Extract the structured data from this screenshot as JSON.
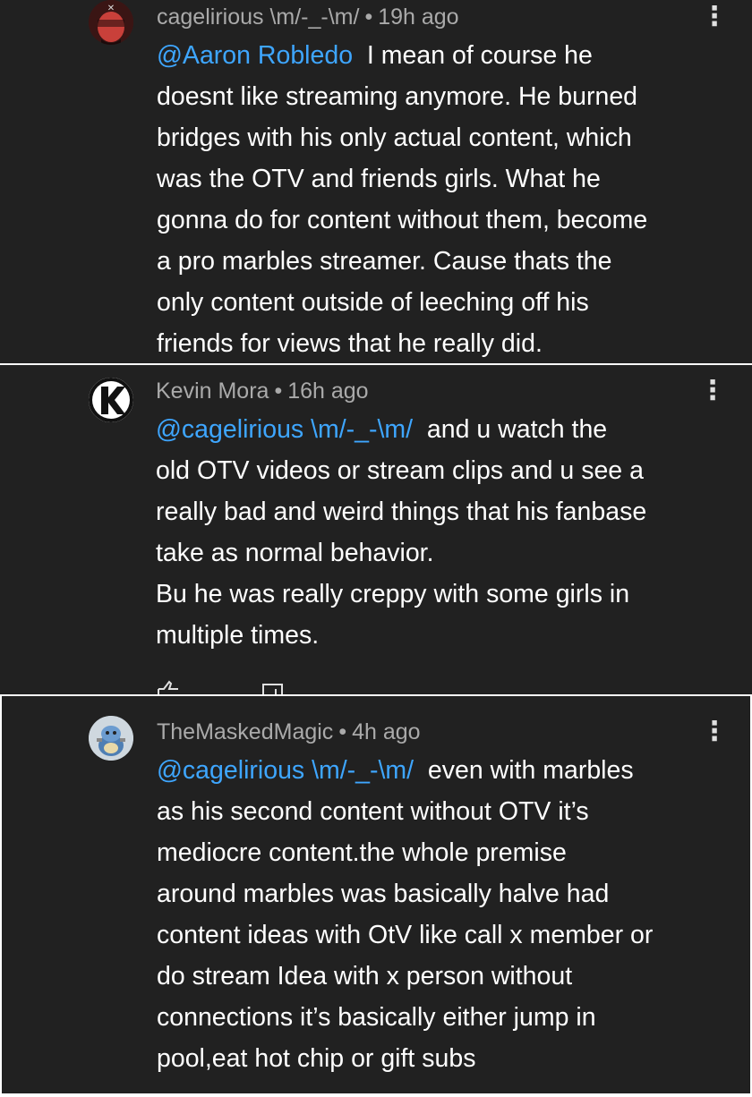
{
  "comments": [
    {
      "author": "cagelirious \\m/-_-\\m/",
      "time": "19h ago",
      "mention": "@Aaron Robledo",
      "text": "I mean of course he\ndoesnt like streaming anymore. He burned\nbridges with his only actual content, which\nwas the OTV and friends girls. What he\ngonna do for content without them, become\na pro marbles streamer. Cause thats the\nonly content outside of leeching off his\nfriends for views that he really did."
    },
    {
      "author": "Kevin Mora",
      "time": "16h ago",
      "mention": "@cagelirious \\m/-_-\\m/",
      "text": "and u watch the\nold OTV videos or stream clips and u see a\nreally bad and weird things that his fanbase\ntake as normal behavior.\nBu he was really creppy with some girls in\nmultiple times."
    },
    {
      "author": "TheMaskedMagic",
      "time": "4h ago",
      "mention": "@cagelirious \\m/-_-\\m/",
      "text": "even with marbles\nas his second content without OTV it’s\nmediocre content.the whole premise\naround marbles was basically halve had\ncontent ideas with OtV like call x member or\ndo stream Idea with x person without\nconnections it’s basically either jump in\npool,eat hot chip or gift subs"
    }
  ],
  "meta_separator": "•",
  "kebab_glyph": "⋮",
  "colors": {
    "background": "#212121",
    "mention": "#3ea6ff",
    "meta": "#aaaaaa",
    "text": "#ffffff"
  },
  "icons": [
    "more-vert-icon",
    "like-icon",
    "reply-icon"
  ]
}
